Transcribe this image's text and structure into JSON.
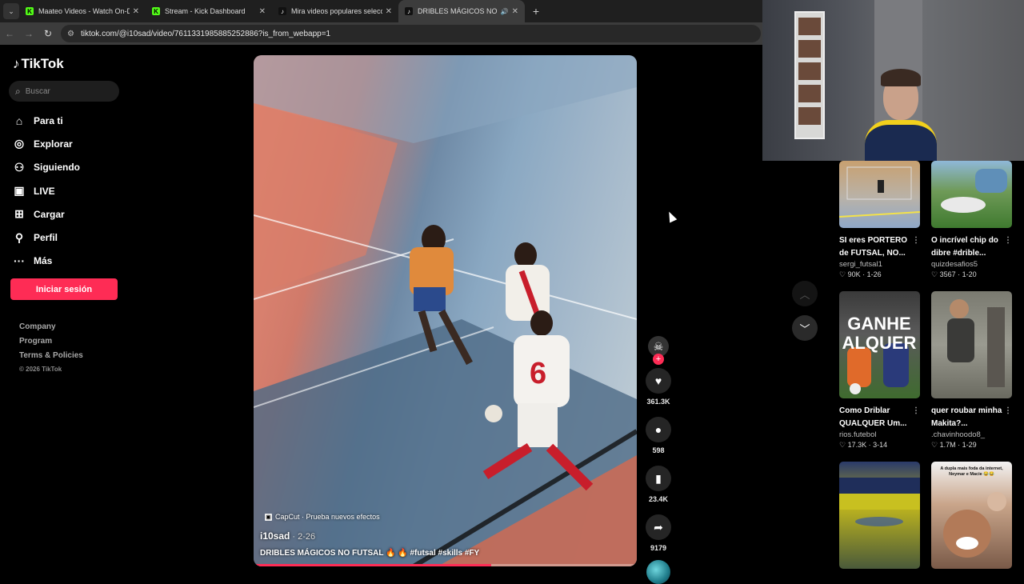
{
  "browser": {
    "tabs": [
      {
        "title": "Maateo Videos - Watch On-De",
        "favicon": "kick",
        "active": false
      },
      {
        "title": "Stream - Kick Dashboard",
        "favicon": "kick",
        "active": false
      },
      {
        "title": "Mira videos populares seleccio",
        "favicon": "tiktok",
        "active": false
      },
      {
        "title": "DRIBLES MÁGICOS NO FUT",
        "favicon": "tiktok",
        "active": true
      }
    ],
    "url": "tiktok.com/@i10sad/video/7611331985885252886?is_from_webapp=1"
  },
  "sidebar": {
    "logo": "TikTok",
    "search_placeholder": "Buscar",
    "items": [
      {
        "label": "Para ti",
        "icon": "home-icon"
      },
      {
        "label": "Explorar",
        "icon": "compass-icon"
      },
      {
        "label": "Siguiendo",
        "icon": "following-icon"
      },
      {
        "label": "LIVE",
        "icon": "live-icon"
      },
      {
        "label": "Cargar",
        "icon": "upload-icon"
      },
      {
        "label": "Perfil",
        "icon": "profile-icon"
      },
      {
        "label": "Más",
        "icon": "more-icon"
      }
    ],
    "login_label": "Iniciar sesión",
    "footer_links": [
      "Company",
      "Program",
      "Terms & Policies"
    ],
    "copyright": "© 2026 TikTok"
  },
  "video": {
    "effect_label": "CapCut · Prueba nuevos efectos",
    "author": "i10sad",
    "date": " · 2-26",
    "description": "DRIBLES MÁGICOS NO FUTSAL 🔥 🔥 #futsal #skills #FY",
    "progress": 0.62
  },
  "actions": {
    "likes": "361.3K",
    "comments": "598",
    "saves": "23.4K",
    "shares": "9179"
  },
  "grid": [
    {
      "title": "SI eres PORTERO de FUTSAL, NO...",
      "user": "sergi_futsal1",
      "likes": "90K",
      "date": "1-26"
    },
    {
      "title": "O incrível chip do dibre #drible...",
      "user": "quizdesafios5",
      "likes": "3567",
      "date": "1-20"
    },
    {
      "title": "Como Driblar QUALQUER Um...",
      "user": "rios.futebol",
      "likes": "17.3K",
      "date": "3-14",
      "thumb_text": "GANHE\nALQUER"
    },
    {
      "title": "quer roubar minha Makita?...",
      "user": ".chavinhoodo8_",
      "likes": "1.7M",
      "date": "1-29"
    },
    {
      "title": "",
      "user": "",
      "likes": "",
      "date": ""
    },
    {
      "title": "",
      "user": "",
      "likes": "",
      "date": "",
      "thumb_text": "A dupla mais foda da internet, Neymar e Macie 😂😂"
    }
  ]
}
